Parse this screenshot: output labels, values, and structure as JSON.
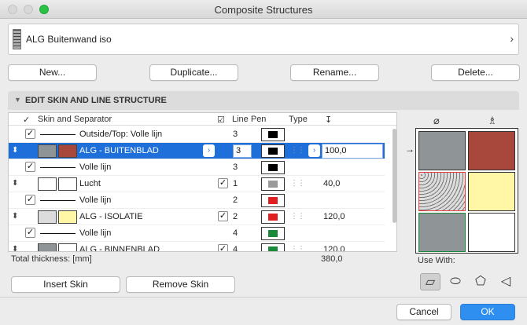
{
  "window": {
    "title": "Composite Structures"
  },
  "selector": {
    "name": "ALG Buitenwand iso"
  },
  "buttons": {
    "new": "New...",
    "duplicate": "Duplicate...",
    "rename": "Rename...",
    "delete": "Delete..."
  },
  "section": {
    "label": "EDIT SKIN AND LINE STRUCTURE"
  },
  "table": {
    "headers": {
      "skin_and_separator": "Skin and Separator",
      "line_pen": "Line Pen",
      "type": "Type",
      "thickness_icon": "↧"
    },
    "rows": [
      {
        "kind": "line",
        "checked": true,
        "name": "Outside/Top: Volle lijn",
        "pen": "3",
        "pen_color": "#000000"
      },
      {
        "kind": "skin",
        "name": "ALG - BUITENBLAD",
        "fill_a": "#8f9497",
        "fill_b": "#a8483c",
        "pen": "3",
        "pen_color": "#000000",
        "thickness": "100,0",
        "selected": true
      },
      {
        "kind": "line",
        "checked": true,
        "name": "Volle lijn",
        "pen": "3",
        "pen_color": "#000000"
      },
      {
        "kind": "skin",
        "name": "Lucht",
        "fill_a": "#ffffff",
        "fill_b": "#ffffff",
        "core": true,
        "pen": "1",
        "pen_color": "#9a9a9a",
        "thickness": "40,0"
      },
      {
        "kind": "line",
        "checked": true,
        "name": "Volle lijn",
        "pen": "2",
        "pen_color": "#e02020"
      },
      {
        "kind": "skin",
        "name": "ALG - ISOLATIE",
        "fill_a": "#dcdcdc",
        "fill_b": "#fff6a6",
        "core": true,
        "pen": "2",
        "pen_color": "#e02020",
        "thickness": "120,0"
      },
      {
        "kind": "line",
        "checked": true,
        "name": "Volle lijn",
        "pen": "4",
        "pen_color": "#1a8a3a"
      },
      {
        "kind": "skin",
        "name": "ALG - BINNENBLAD",
        "fill_a": "#8f9497",
        "fill_b": "#ffffff",
        "core": true,
        "pen": "4",
        "pen_color": "#1a8a3a",
        "thickness": "120,0"
      }
    ]
  },
  "total": {
    "label": "Total thickness: [mm]",
    "value": "380,0"
  },
  "skin_buttons": {
    "insert": "Insert Skin",
    "remove": "Remove Skin"
  },
  "use_with": {
    "label": "Use With:"
  },
  "footer": {
    "cancel": "Cancel",
    "ok": "OK"
  },
  "colors": {
    "accent": "#1e6fd9",
    "ok_button": "#2f8ff0"
  }
}
